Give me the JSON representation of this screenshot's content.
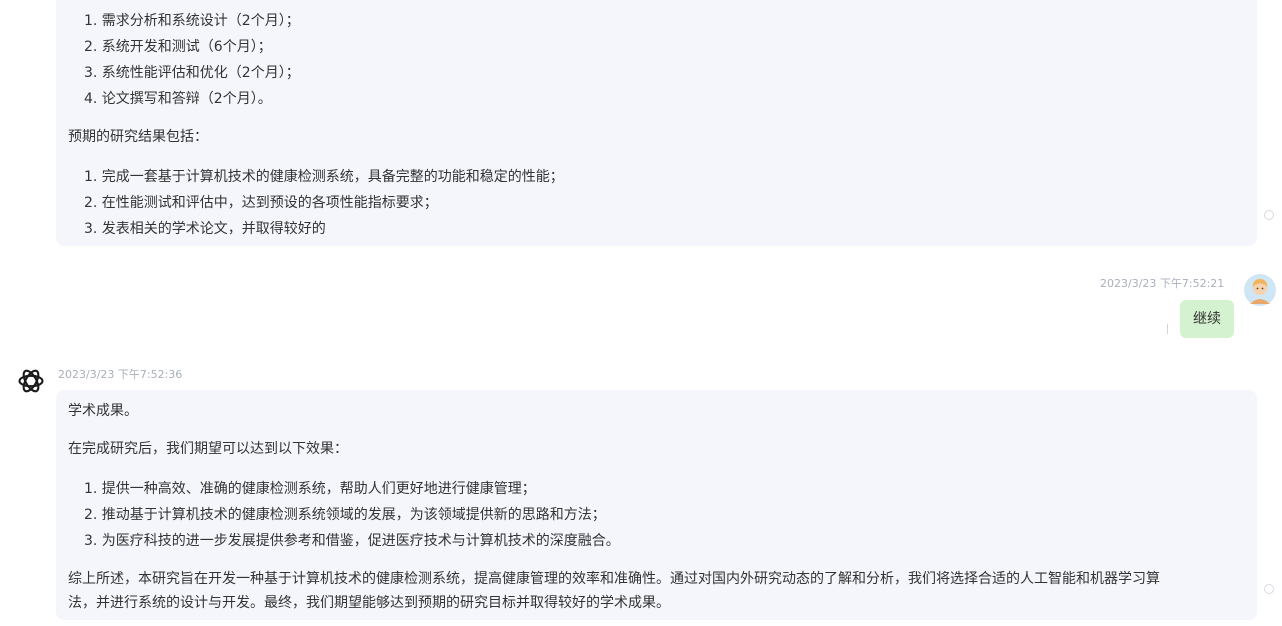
{
  "top_message": {
    "list1": [
      "1. 需求分析和系统设计（2个月）；",
      "2. 系统开发和测试（6个月）；",
      "3. 系统性能评估和优化（2个月）；",
      "4. 论文撰写和答辩（2个月）。"
    ],
    "intro": "预期的研究结果包括：",
    "list2": [
      "1. 完成一套基于计算机技术的健康检测系统，具备完整的功能和稳定的性能；",
      "2. 在性能测试和评估中，达到预设的各项性能指标要求；",
      "3. 发表相关的学术论文，并取得较好的"
    ]
  },
  "user_message": {
    "timestamp": "2023/3/23 下午7:52:21",
    "text": "继续",
    "avatar": "user-avatar-icon"
  },
  "bot_message": {
    "timestamp": "2023/3/23 下午7:52:36",
    "icon": "chatgpt-logo-icon",
    "line1": "学术成果。",
    "line2": "在完成研究后，我们期望可以达到以下效果：",
    "list": [
      "1. 提供一种高效、准确的健康检测系统，帮助人们更好地进行健康管理；",
      "2. 推动基于计算机技术的健康检测系统领域的发展，为该领域提供新的思路和方法；",
      "3. 为医疗科技的进一步发展提供参考和借鉴，促进医疗技术与计算机技术的深度融合。"
    ],
    "summary_line1": "综上所述，本研究旨在开发一种基于计算机技术的健康检测系统，提高健康管理的效率和准确性。通过对国内外研究动态的了解和分析，我们将选择合适的人工智能和机器学习算",
    "summary_line2": "法，并进行系统的设计与开发。最终，我们期望能够达到预期的研究目标并取得较好的学术成果。"
  },
  "colors": {
    "bubble_bg": "#f4f6fb",
    "user_bubble_bg": "#d4f2cf",
    "timestamp": "#a9b0bc"
  }
}
